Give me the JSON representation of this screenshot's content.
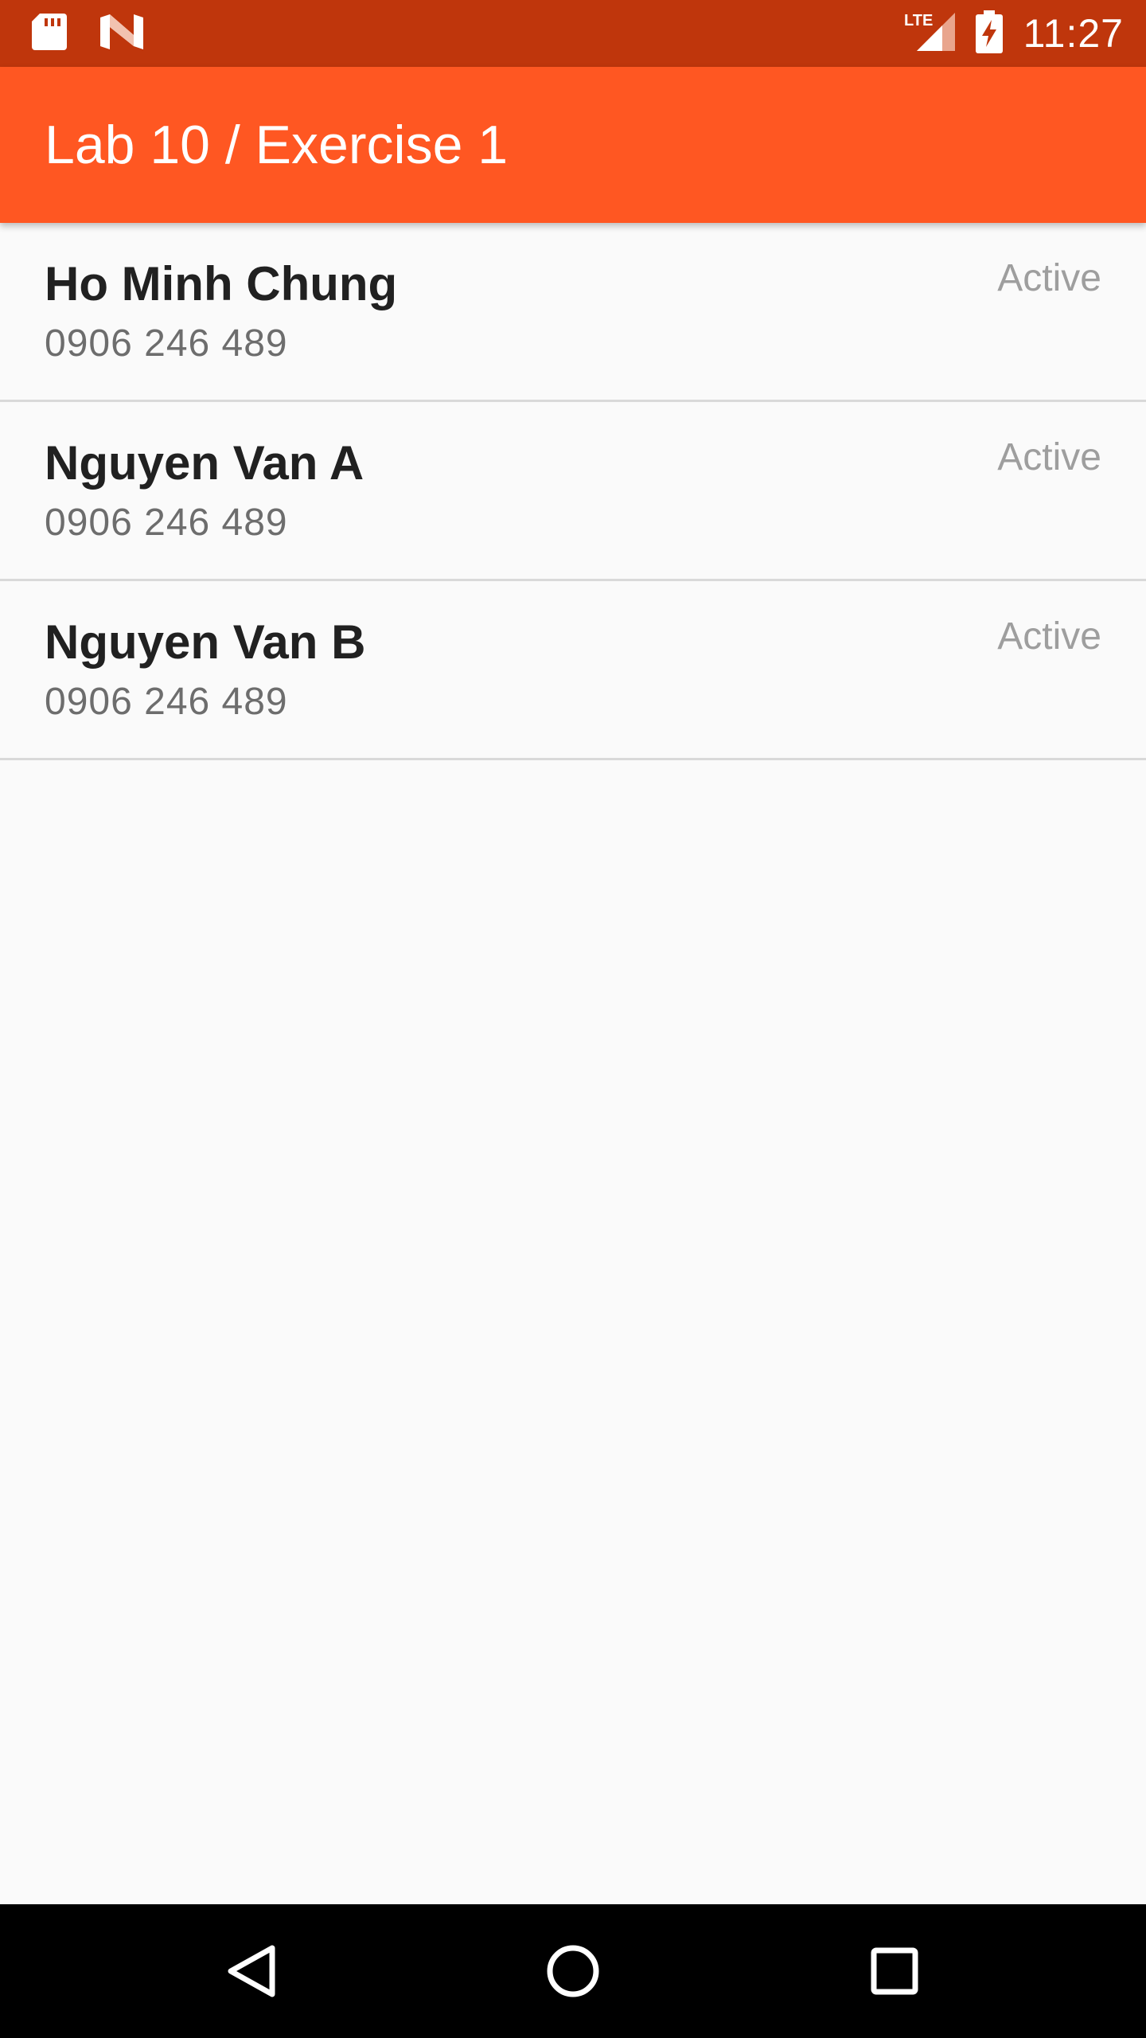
{
  "status_bar": {
    "time": "11:27",
    "network": "LTE",
    "icons": [
      "sd-card-icon",
      "n-notification-icon",
      "lte-signal-icon",
      "battery-charging-icon"
    ],
    "color": "#bf360c"
  },
  "app_bar": {
    "title": "Lab 10 / Exercise 1",
    "color": "#ff5722"
  },
  "contacts": [
    {
      "name": "Ho Minh Chung",
      "phone": "0906 246 489",
      "status": "Active"
    },
    {
      "name": "Nguyen Van A",
      "phone": "0906 246 489",
      "status": "Active"
    },
    {
      "name": "Nguyen Van B",
      "phone": "0906 246 489",
      "status": "Active"
    }
  ],
  "nav_bar": {
    "icons": [
      "back-icon",
      "home-icon",
      "recent-apps-icon"
    ]
  }
}
